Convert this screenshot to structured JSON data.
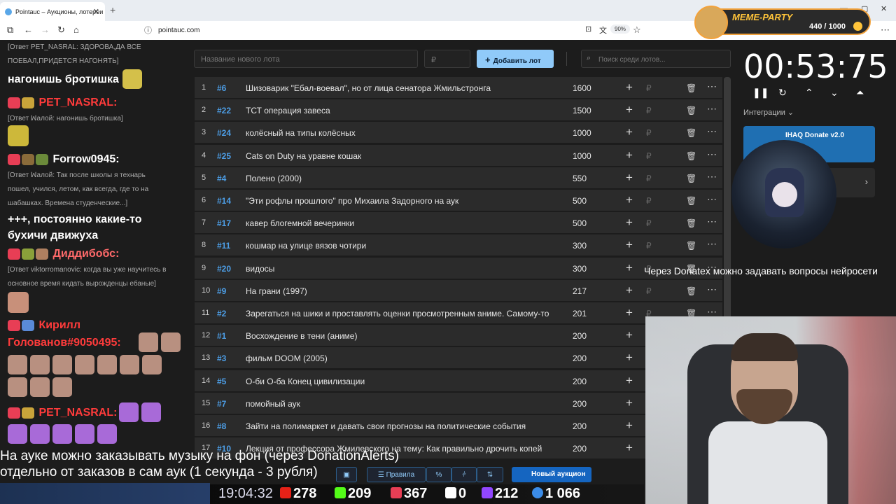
{
  "browser": {
    "tab_title": "Pointauc – Аукционы, лотереи",
    "url": "pointauc.com",
    "zoom": "90%"
  },
  "meme_party": {
    "title": "MEME-PARTY",
    "count": "440 / 1000"
  },
  "chat": {
    "lines": [
      {
        "type": "reply",
        "text": "[Ответ PET_NASRAL: ЗДОРОВА,ДА ВСЕ"
      },
      {
        "type": "reply",
        "text": "ПОЕБАЛ,ПРИДЕТСЯ НАГОНЯТЬ]"
      },
      {
        "type": "msg",
        "text": "нагонишь бротишка"
      },
      {
        "type": "nick",
        "text": "PET_NASRAL:",
        "color": "#ff3b3b"
      },
      {
        "type": "reply",
        "text": "[Ответ ꟽaлой: нагонишь бротишка]"
      },
      {
        "type": "nick",
        "text": "Forrow0945:",
        "color": "#ffffff"
      },
      {
        "type": "reply",
        "text": "[Ответ ꟽaлой: Так после школы я технарь"
      },
      {
        "type": "reply",
        "text": "пошел, учился, летом, как всегда, где то на"
      },
      {
        "type": "reply",
        "text": "шабашках. Времена студенческие...]"
      },
      {
        "type": "msg",
        "text": "+++, постоянно какие-то"
      },
      {
        "type": "msg",
        "text": "бухичи движуха"
      },
      {
        "type": "nick",
        "text": "Диддибобс:",
        "color": "#ff6a6a"
      },
      {
        "type": "reply",
        "text": "[Ответ viktorromanovic: когда вы уже научитесь в"
      },
      {
        "type": "reply",
        "text": "основное время кидать вырожденцы ебаные]"
      },
      {
        "type": "nick",
        "text": "Кирилл",
        "color": "#ff3b3b"
      },
      {
        "type": "nick",
        "text": "Голованов#9050495:",
        "color": "#ff3b3b"
      },
      {
        "type": "nick",
        "text": "PET_NASRAL:",
        "color": "#ff3b3b"
      }
    ]
  },
  "controls": {
    "lot_placeholder": "Название нового лота",
    "amount_placeholder": "₽",
    "add_label": "Добавить лот",
    "search_placeholder": "Поиск среди лотов..."
  },
  "lots": [
    {
      "idx": "1",
      "hash": "#6",
      "name": "Шизоварик \"Ебал-воевал\", но от лица сенатора Жмильстронга",
      "amount": "1600"
    },
    {
      "idx": "2",
      "hash": "#22",
      "name": "ТСТ операция завеса",
      "amount": "1500"
    },
    {
      "idx": "3",
      "hash": "#24",
      "name": "колёсный на типы колёсных",
      "amount": "1000"
    },
    {
      "idx": "4",
      "hash": "#25",
      "name": "Cats on Duty на уравне кошак",
      "amount": "1000"
    },
    {
      "idx": "5",
      "hash": "#4",
      "name": "Полено (2000)",
      "amount": "550"
    },
    {
      "idx": "6",
      "hash": "#14",
      "name": "\"Эти рофлы прошлого\" про Михаила Задорного на аук",
      "amount": "500"
    },
    {
      "idx": "7",
      "hash": "#17",
      "name": "кавер блогемной вечеринки",
      "amount": "500"
    },
    {
      "idx": "8",
      "hash": "#11",
      "name": "кошмар на улице вязов чотири",
      "amount": "300"
    },
    {
      "idx": "9",
      "hash": "#20",
      "name": "видосы",
      "amount": "300"
    },
    {
      "idx": "10",
      "hash": "#9",
      "name": "На грани (1997)",
      "amount": "217"
    },
    {
      "idx": "11",
      "hash": "#2",
      "name": "Зарегаться на шики и проставлять оценки просмотренным аниме. Самому-то",
      "amount": "201"
    },
    {
      "idx": "12",
      "hash": "#1",
      "name": "Восхождение в тени (аниме)",
      "amount": "200"
    },
    {
      "idx": "13",
      "hash": "#3",
      "name": "фильм DOOM (2005)",
      "amount": "200"
    },
    {
      "idx": "14",
      "hash": "#5",
      "name": "О-би О-ба Конец цивилизации",
      "amount": "200"
    },
    {
      "idx": "15",
      "hash": "#7",
      "name": "помойный аук",
      "amount": "200"
    },
    {
      "idx": "16",
      "hash": "#8",
      "name": "Зайти на полимаркет и давать свои прогнозы на политические события",
      "amount": "200"
    },
    {
      "idx": "17",
      "hash": "#10",
      "name": "Лекция от профессора Жмилевского на тему: Как правильно дрочить копей",
      "amount": "200"
    }
  ],
  "timer": {
    "value": "00:53:75",
    "integrations_label": "Интеграции"
  },
  "donate": {
    "title": "IHAQ Donate v2.0"
  },
  "captions": {
    "right": "Через Donatex можно задавать вопросы нейросети",
    "bottom_1": "На ауке можно заказывать музыку на фон (через DonationAlerts)",
    "bottom_2": "отдельно от заказов в сам аук (1 секунда - 3 рубля)"
  },
  "bottom_bar": {
    "rules_label": "Правила",
    "new_auction_label": "Новый аукцион"
  },
  "stats": {
    "time": "19:04:32",
    "youtube": "278",
    "kick": "209",
    "live": "367",
    "r": "0",
    "twitch": "212",
    "viewers": "1 066"
  },
  "colors": {
    "accent": "#90caf9",
    "hash": "#4d9fe8",
    "live": "#e83e55"
  }
}
